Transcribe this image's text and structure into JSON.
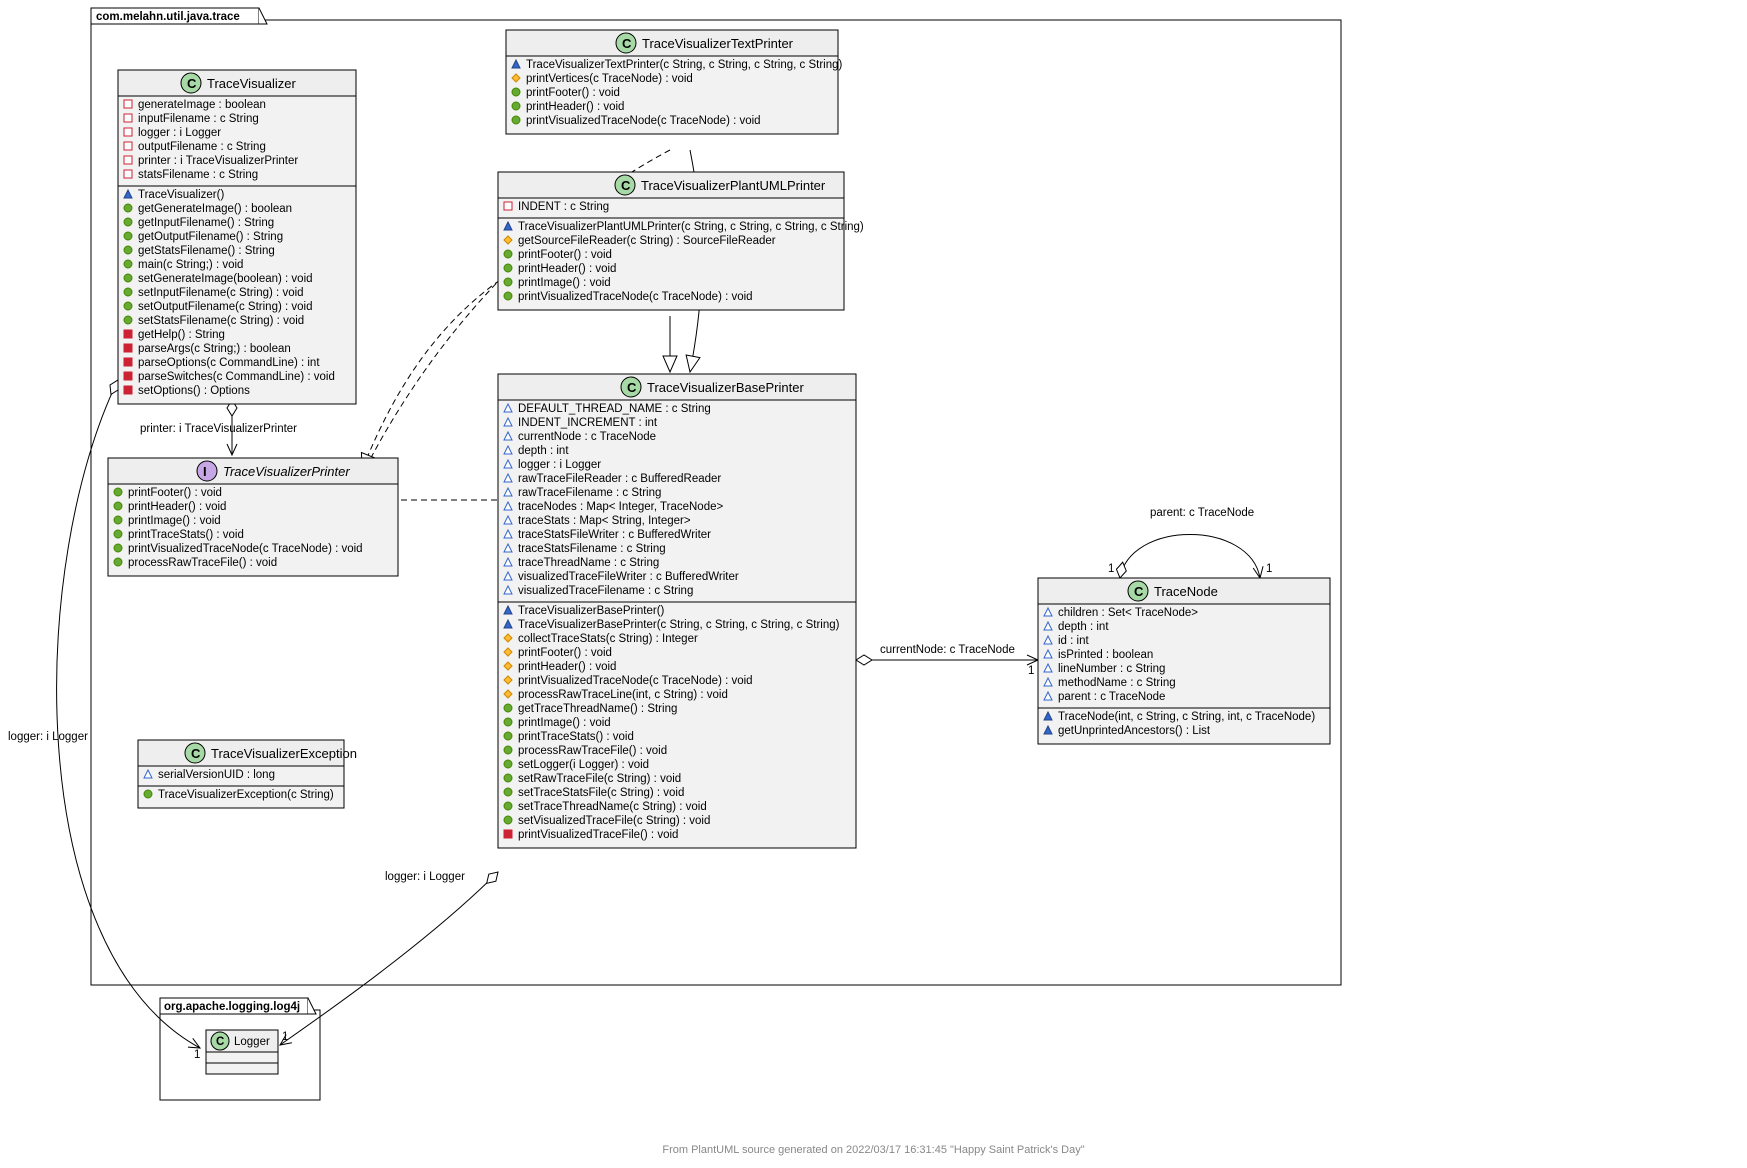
{
  "package_main": "com.melahn.util.java.trace",
  "package_log4j": "org.apache.logging.log4j",
  "footer": "From PlantUML source generated on 2022/03/17 16:31:45 \"Happy Saint Patrick's Day\"",
  "relations": {
    "printer_label": "printer: i TraceVisualizerPrinter",
    "logger_label": "logger: i Logger",
    "currentNode_label": "currentNode: c TraceNode",
    "parent_label": "parent: c TraceNode",
    "one": "1"
  },
  "classes": {
    "TraceVisualizer": {
      "name": "TraceVisualizer",
      "stereotype": "C",
      "fields": [
        {
          "icon": "pri-sq",
          "text": "generateImage : boolean"
        },
        {
          "icon": "pri-sq",
          "text": "inputFilename : c String"
        },
        {
          "icon": "pri-sq",
          "text": "logger : i Logger"
        },
        {
          "icon": "pri-sq",
          "text": "outputFilename : c String"
        },
        {
          "icon": "pri-sq",
          "text": "printer : i TraceVisualizerPrinter"
        },
        {
          "icon": "pri-sq",
          "text": "statsFilename : c String"
        }
      ],
      "methods": [
        {
          "icon": "ctor",
          "text": "TraceVisualizer()"
        },
        {
          "icon": "pub",
          "text": "getGenerateImage()  : boolean"
        },
        {
          "icon": "pub",
          "text": "getInputFilename()  : String"
        },
        {
          "icon": "pub",
          "text": "getOutputFilename()  : String"
        },
        {
          "icon": "pub",
          "text": "getStatsFilename()  : String"
        },
        {
          "icon": "pub",
          "text": "main(c String;)  : void"
        },
        {
          "icon": "pub",
          "text": "setGenerateImage(boolean)  : void"
        },
        {
          "icon": "pub",
          "text": "setInputFilename(c String)  : void"
        },
        {
          "icon": "pub",
          "text": "setOutputFilename(c String)  : void"
        },
        {
          "icon": "pub",
          "text": "setStatsFilename(c String)  : void"
        },
        {
          "icon": "priv",
          "text": "getHelp()  : String"
        },
        {
          "icon": "priv",
          "text": "parseArgs(c String;)  : boolean"
        },
        {
          "icon": "priv",
          "text": "parseOptions(c CommandLine)  : int"
        },
        {
          "icon": "priv",
          "text": "parseSwitches(c CommandLine)  : void"
        },
        {
          "icon": "priv",
          "text": "setOptions()  : Options"
        }
      ]
    },
    "TraceVisualizerTextPrinter": {
      "name": "TraceVisualizerTextPrinter",
      "stereotype": "C",
      "methods": [
        {
          "icon": "ctor",
          "text": "TraceVisualizerTextPrinter(c String, c String, c String, c String)"
        },
        {
          "icon": "prot",
          "text": "printVertices(c TraceNode)  : void"
        },
        {
          "icon": "pub",
          "text": "printFooter()  : void"
        },
        {
          "icon": "pub",
          "text": "printHeader()  : void"
        },
        {
          "icon": "pub",
          "text": "printVisualizedTraceNode(c TraceNode)  : void"
        }
      ]
    },
    "TraceVisualizerPlantUMLPrinter": {
      "name": "TraceVisualizerPlantUMLPrinter",
      "stereotype": "C",
      "fields": [
        {
          "icon": "pri-sq",
          "text": "INDENT : c String"
        }
      ],
      "methods": [
        {
          "icon": "ctor",
          "text": "TraceVisualizerPlantUMLPrinter(c String, c String, c String, c String)"
        },
        {
          "icon": "prot",
          "text": "getSourceFileReader(c String)  : SourceFileReader"
        },
        {
          "icon": "pub",
          "text": "printFooter()  : void"
        },
        {
          "icon": "pub",
          "text": "printHeader()  : void"
        },
        {
          "icon": "pub",
          "text": "printImage()  : void"
        },
        {
          "icon": "pub",
          "text": "printVisualizedTraceNode(c TraceNode)  : void"
        }
      ]
    },
    "TraceVisualizerBasePrinter": {
      "name": "TraceVisualizerBasePrinter",
      "stereotype": "C",
      "fields": [
        {
          "icon": "pkg-tri",
          "text": "DEFAULT_THREAD_NAME : c String"
        },
        {
          "icon": "pkg-tri",
          "text": "INDENT_INCREMENT : int"
        },
        {
          "icon": "pkg-tri",
          "text": "currentNode : c TraceNode"
        },
        {
          "icon": "pkg-tri",
          "text": "depth : int"
        },
        {
          "icon": "pkg-tri",
          "text": "logger : i Logger"
        },
        {
          "icon": "pkg-tri",
          "text": "rawTraceFileReader : c BufferedReader"
        },
        {
          "icon": "pkg-tri",
          "text": "rawTraceFilename : c String"
        },
        {
          "icon": "pkg-tri",
          "text": "traceNodes :  Map< Integer, TraceNode>"
        },
        {
          "icon": "pkg-tri",
          "text": "traceStats :  Map< String, Integer>"
        },
        {
          "icon": "pkg-tri",
          "text": "traceStatsFileWriter : c BufferedWriter"
        },
        {
          "icon": "pkg-tri",
          "text": "traceStatsFilename : c String"
        },
        {
          "icon": "pkg-tri",
          "text": "traceThreadName : c String"
        },
        {
          "icon": "pkg-tri",
          "text": "visualizedTraceFileWriter : c BufferedWriter"
        },
        {
          "icon": "pkg-tri",
          "text": "visualizedTraceFilename : c String"
        }
      ],
      "methods": [
        {
          "icon": "ctor",
          "text": "TraceVisualizerBasePrinter()"
        },
        {
          "icon": "ctor",
          "text": "TraceVisualizerBasePrinter(c String, c String, c String, c String)"
        },
        {
          "icon": "prot",
          "text": "collectTraceStats(c String)  : Integer"
        },
        {
          "icon": "prot",
          "text": "printFooter()  : void"
        },
        {
          "icon": "prot",
          "text": "printHeader()  : void"
        },
        {
          "icon": "prot",
          "text": "printVisualizedTraceNode(c TraceNode)  : void"
        },
        {
          "icon": "prot",
          "text": "processRawTraceLine(int, c String)  : void"
        },
        {
          "icon": "pub",
          "text": "getTraceThreadName()  : String"
        },
        {
          "icon": "pub",
          "text": "printImage()  : void"
        },
        {
          "icon": "pub",
          "text": "printTraceStats()  : void"
        },
        {
          "icon": "pub",
          "text": "processRawTraceFile()  : void"
        },
        {
          "icon": "pub",
          "text": "setLogger(i Logger)  : void"
        },
        {
          "icon": "pub",
          "text": "setRawTraceFile(c String)  : void"
        },
        {
          "icon": "pub",
          "text": "setTraceStatsFile(c String)  : void"
        },
        {
          "icon": "pub",
          "text": "setTraceThreadName(c String)  : void"
        },
        {
          "icon": "pub",
          "text": "setVisualizedTraceFile(c String)  : void"
        },
        {
          "icon": "priv",
          "text": "printVisualizedTraceFile()  : void"
        }
      ]
    },
    "TraceVisualizerPrinter": {
      "name": "TraceVisualizerPrinter",
      "stereotype": "I",
      "methods": [
        {
          "icon": "pub",
          "text": "printFooter()  : void"
        },
        {
          "icon": "pub",
          "text": "printHeader()  : void"
        },
        {
          "icon": "pub",
          "text": "printImage()  : void"
        },
        {
          "icon": "pub",
          "text": "printTraceStats()  : void"
        },
        {
          "icon": "pub",
          "text": "printVisualizedTraceNode(c TraceNode)  : void"
        },
        {
          "icon": "pub",
          "text": "processRawTraceFile()  : void"
        }
      ]
    },
    "TraceVisualizerException": {
      "name": "TraceVisualizerException",
      "stereotype": "C",
      "fields": [
        {
          "icon": "pkg-tri",
          "text": "serialVersionUID : long"
        }
      ],
      "methods": [
        {
          "icon": "pub",
          "text": "TraceVisualizerException(c String)"
        }
      ]
    },
    "TraceNode": {
      "name": "TraceNode",
      "stereotype": "C",
      "fields": [
        {
          "icon": "pkg-tri",
          "text": "children :  Set< TraceNode>"
        },
        {
          "icon": "pkg-tri",
          "text": "depth : int"
        },
        {
          "icon": "pkg-tri",
          "text": "id : int"
        },
        {
          "icon": "pkg-tri",
          "text": "isPrinted : boolean"
        },
        {
          "icon": "pkg-tri",
          "text": "lineNumber : c String"
        },
        {
          "icon": "pkg-tri",
          "text": "methodName : c String"
        },
        {
          "icon": "pkg-tri",
          "text": "parent : c TraceNode"
        }
      ],
      "methods": [
        {
          "icon": "ctor",
          "text": "TraceNode(int, c String, c String, int, c TraceNode)"
        },
        {
          "icon": "ctor",
          "text": "getUnprintedAncestors()  : List"
        }
      ]
    },
    "Logger": {
      "name": "Logger",
      "stereotype": "C"
    }
  }
}
